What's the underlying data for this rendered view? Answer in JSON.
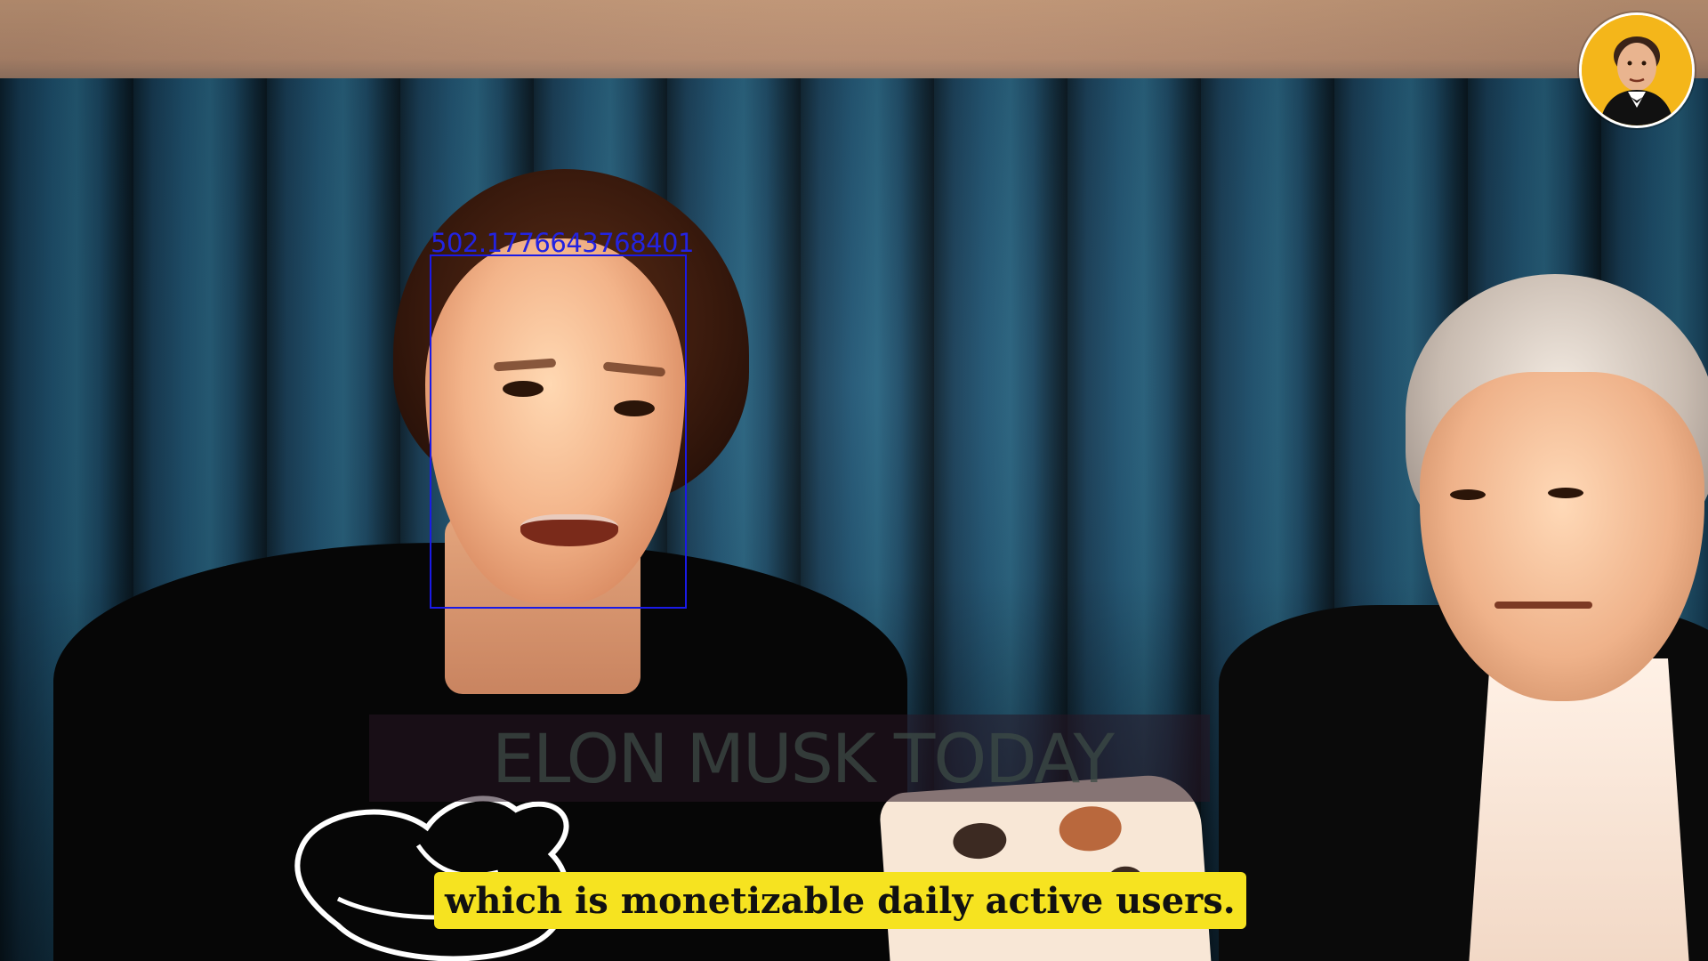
{
  "video": {
    "caption": "which is monetizable daily active users.",
    "watermark": "ELON MUSK TODAY",
    "detection_label": "502.1776643768401",
    "channel_logo": "elon-musk-avatar-icon"
  },
  "colors": {
    "caption_background": "#f6e320",
    "caption_text": "#111111",
    "detection_box": "#1a1ae6",
    "logo_background": "#f4b61a"
  }
}
